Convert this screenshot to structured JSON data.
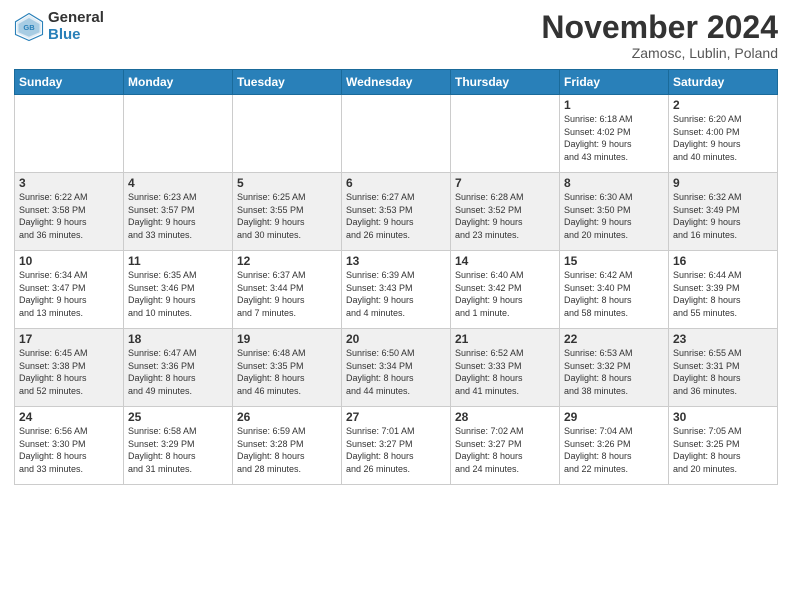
{
  "header": {
    "logo_general": "General",
    "logo_blue": "Blue",
    "month_title": "November 2024",
    "location": "Zamosc, Lublin, Poland"
  },
  "days_of_week": [
    "Sunday",
    "Monday",
    "Tuesday",
    "Wednesday",
    "Thursday",
    "Friday",
    "Saturday"
  ],
  "weeks": [
    [
      {
        "day": "",
        "info": ""
      },
      {
        "day": "",
        "info": ""
      },
      {
        "day": "",
        "info": ""
      },
      {
        "day": "",
        "info": ""
      },
      {
        "day": "",
        "info": ""
      },
      {
        "day": "1",
        "info": "Sunrise: 6:18 AM\nSunset: 4:02 PM\nDaylight: 9 hours\nand 43 minutes."
      },
      {
        "day": "2",
        "info": "Sunrise: 6:20 AM\nSunset: 4:00 PM\nDaylight: 9 hours\nand 40 minutes."
      }
    ],
    [
      {
        "day": "3",
        "info": "Sunrise: 6:22 AM\nSunset: 3:58 PM\nDaylight: 9 hours\nand 36 minutes."
      },
      {
        "day": "4",
        "info": "Sunrise: 6:23 AM\nSunset: 3:57 PM\nDaylight: 9 hours\nand 33 minutes."
      },
      {
        "day": "5",
        "info": "Sunrise: 6:25 AM\nSunset: 3:55 PM\nDaylight: 9 hours\nand 30 minutes."
      },
      {
        "day": "6",
        "info": "Sunrise: 6:27 AM\nSunset: 3:53 PM\nDaylight: 9 hours\nand 26 minutes."
      },
      {
        "day": "7",
        "info": "Sunrise: 6:28 AM\nSunset: 3:52 PM\nDaylight: 9 hours\nand 23 minutes."
      },
      {
        "day": "8",
        "info": "Sunrise: 6:30 AM\nSunset: 3:50 PM\nDaylight: 9 hours\nand 20 minutes."
      },
      {
        "day": "9",
        "info": "Sunrise: 6:32 AM\nSunset: 3:49 PM\nDaylight: 9 hours\nand 16 minutes."
      }
    ],
    [
      {
        "day": "10",
        "info": "Sunrise: 6:34 AM\nSunset: 3:47 PM\nDaylight: 9 hours\nand 13 minutes."
      },
      {
        "day": "11",
        "info": "Sunrise: 6:35 AM\nSunset: 3:46 PM\nDaylight: 9 hours\nand 10 minutes."
      },
      {
        "day": "12",
        "info": "Sunrise: 6:37 AM\nSunset: 3:44 PM\nDaylight: 9 hours\nand 7 minutes."
      },
      {
        "day": "13",
        "info": "Sunrise: 6:39 AM\nSunset: 3:43 PM\nDaylight: 9 hours\nand 4 minutes."
      },
      {
        "day": "14",
        "info": "Sunrise: 6:40 AM\nSunset: 3:42 PM\nDaylight: 9 hours\nand 1 minute."
      },
      {
        "day": "15",
        "info": "Sunrise: 6:42 AM\nSunset: 3:40 PM\nDaylight: 8 hours\nand 58 minutes."
      },
      {
        "day": "16",
        "info": "Sunrise: 6:44 AM\nSunset: 3:39 PM\nDaylight: 8 hours\nand 55 minutes."
      }
    ],
    [
      {
        "day": "17",
        "info": "Sunrise: 6:45 AM\nSunset: 3:38 PM\nDaylight: 8 hours\nand 52 minutes."
      },
      {
        "day": "18",
        "info": "Sunrise: 6:47 AM\nSunset: 3:36 PM\nDaylight: 8 hours\nand 49 minutes."
      },
      {
        "day": "19",
        "info": "Sunrise: 6:48 AM\nSunset: 3:35 PM\nDaylight: 8 hours\nand 46 minutes."
      },
      {
        "day": "20",
        "info": "Sunrise: 6:50 AM\nSunset: 3:34 PM\nDaylight: 8 hours\nand 44 minutes."
      },
      {
        "day": "21",
        "info": "Sunrise: 6:52 AM\nSunset: 3:33 PM\nDaylight: 8 hours\nand 41 minutes."
      },
      {
        "day": "22",
        "info": "Sunrise: 6:53 AM\nSunset: 3:32 PM\nDaylight: 8 hours\nand 38 minutes."
      },
      {
        "day": "23",
        "info": "Sunrise: 6:55 AM\nSunset: 3:31 PM\nDaylight: 8 hours\nand 36 minutes."
      }
    ],
    [
      {
        "day": "24",
        "info": "Sunrise: 6:56 AM\nSunset: 3:30 PM\nDaylight: 8 hours\nand 33 minutes."
      },
      {
        "day": "25",
        "info": "Sunrise: 6:58 AM\nSunset: 3:29 PM\nDaylight: 8 hours\nand 31 minutes."
      },
      {
        "day": "26",
        "info": "Sunrise: 6:59 AM\nSunset: 3:28 PM\nDaylight: 8 hours\nand 28 minutes."
      },
      {
        "day": "27",
        "info": "Sunrise: 7:01 AM\nSunset: 3:27 PM\nDaylight: 8 hours\nand 26 minutes."
      },
      {
        "day": "28",
        "info": "Sunrise: 7:02 AM\nSunset: 3:27 PM\nDaylight: 8 hours\nand 24 minutes."
      },
      {
        "day": "29",
        "info": "Sunrise: 7:04 AM\nSunset: 3:26 PM\nDaylight: 8 hours\nand 22 minutes."
      },
      {
        "day": "30",
        "info": "Sunrise: 7:05 AM\nSunset: 3:25 PM\nDaylight: 8 hours\nand 20 minutes."
      }
    ]
  ]
}
